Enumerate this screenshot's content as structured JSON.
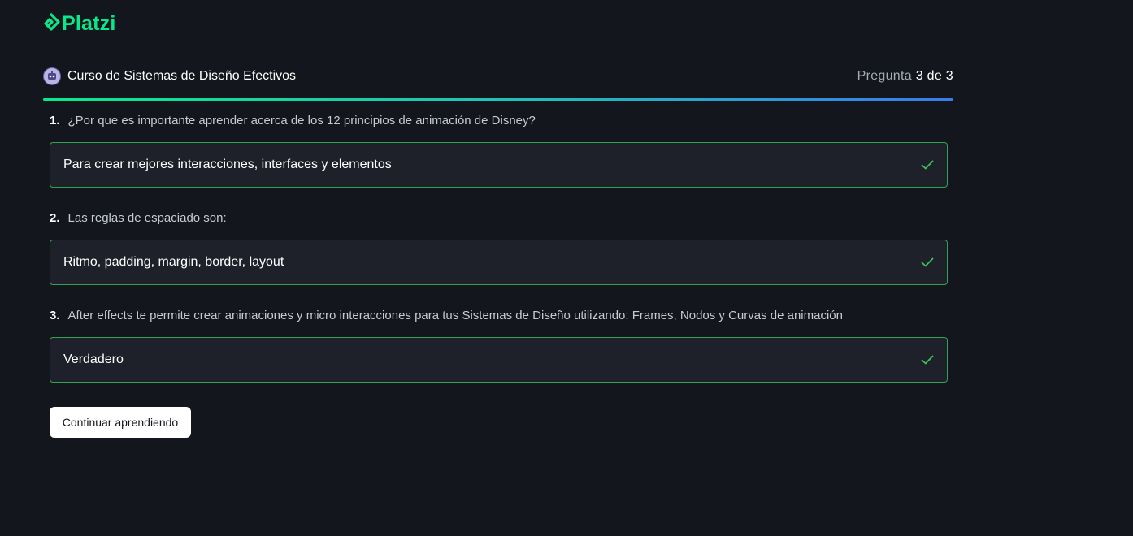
{
  "brand": {
    "name": "Platzi",
    "logo_icon": "platzi-logo-icon",
    "color": "#0ae98a"
  },
  "course": {
    "title": "Curso de Sistemas de Diseño Efectivos",
    "badge_icon": "course-badge-icon"
  },
  "progress": {
    "prefix": "Pregunta",
    "current": "3",
    "separator": "de",
    "total": "3",
    "fraction": 1.0
  },
  "questions": [
    {
      "number": "1.",
      "text": "¿Por que es importante aprender acerca de los 12 principios de animación de Disney?",
      "answer": "Para crear mejores interacciones, interfaces y elementos",
      "status_icon": "check-icon",
      "correct": true
    },
    {
      "number": "2.",
      "text": "Las reglas de espaciado son:",
      "answer": "Ritmo, padding, margin, border, layout",
      "status_icon": "check-icon",
      "correct": true
    },
    {
      "number": "3.",
      "text": "After effects te permite crear animaciones y micro interacciones para tus Sistemas de Diseño utilizando: Frames, Nodos y Curvas de animación",
      "answer": "Verdadero",
      "status_icon": "check-icon",
      "correct": true
    }
  ],
  "actions": {
    "continue_label": "Continuar aprendiendo"
  },
  "colors": {
    "background": "#13161c",
    "answer_border": "#2fa44d",
    "check": "#3fbf5a",
    "progress_start": "#0ae98a",
    "progress_end": "#3a7bea"
  }
}
